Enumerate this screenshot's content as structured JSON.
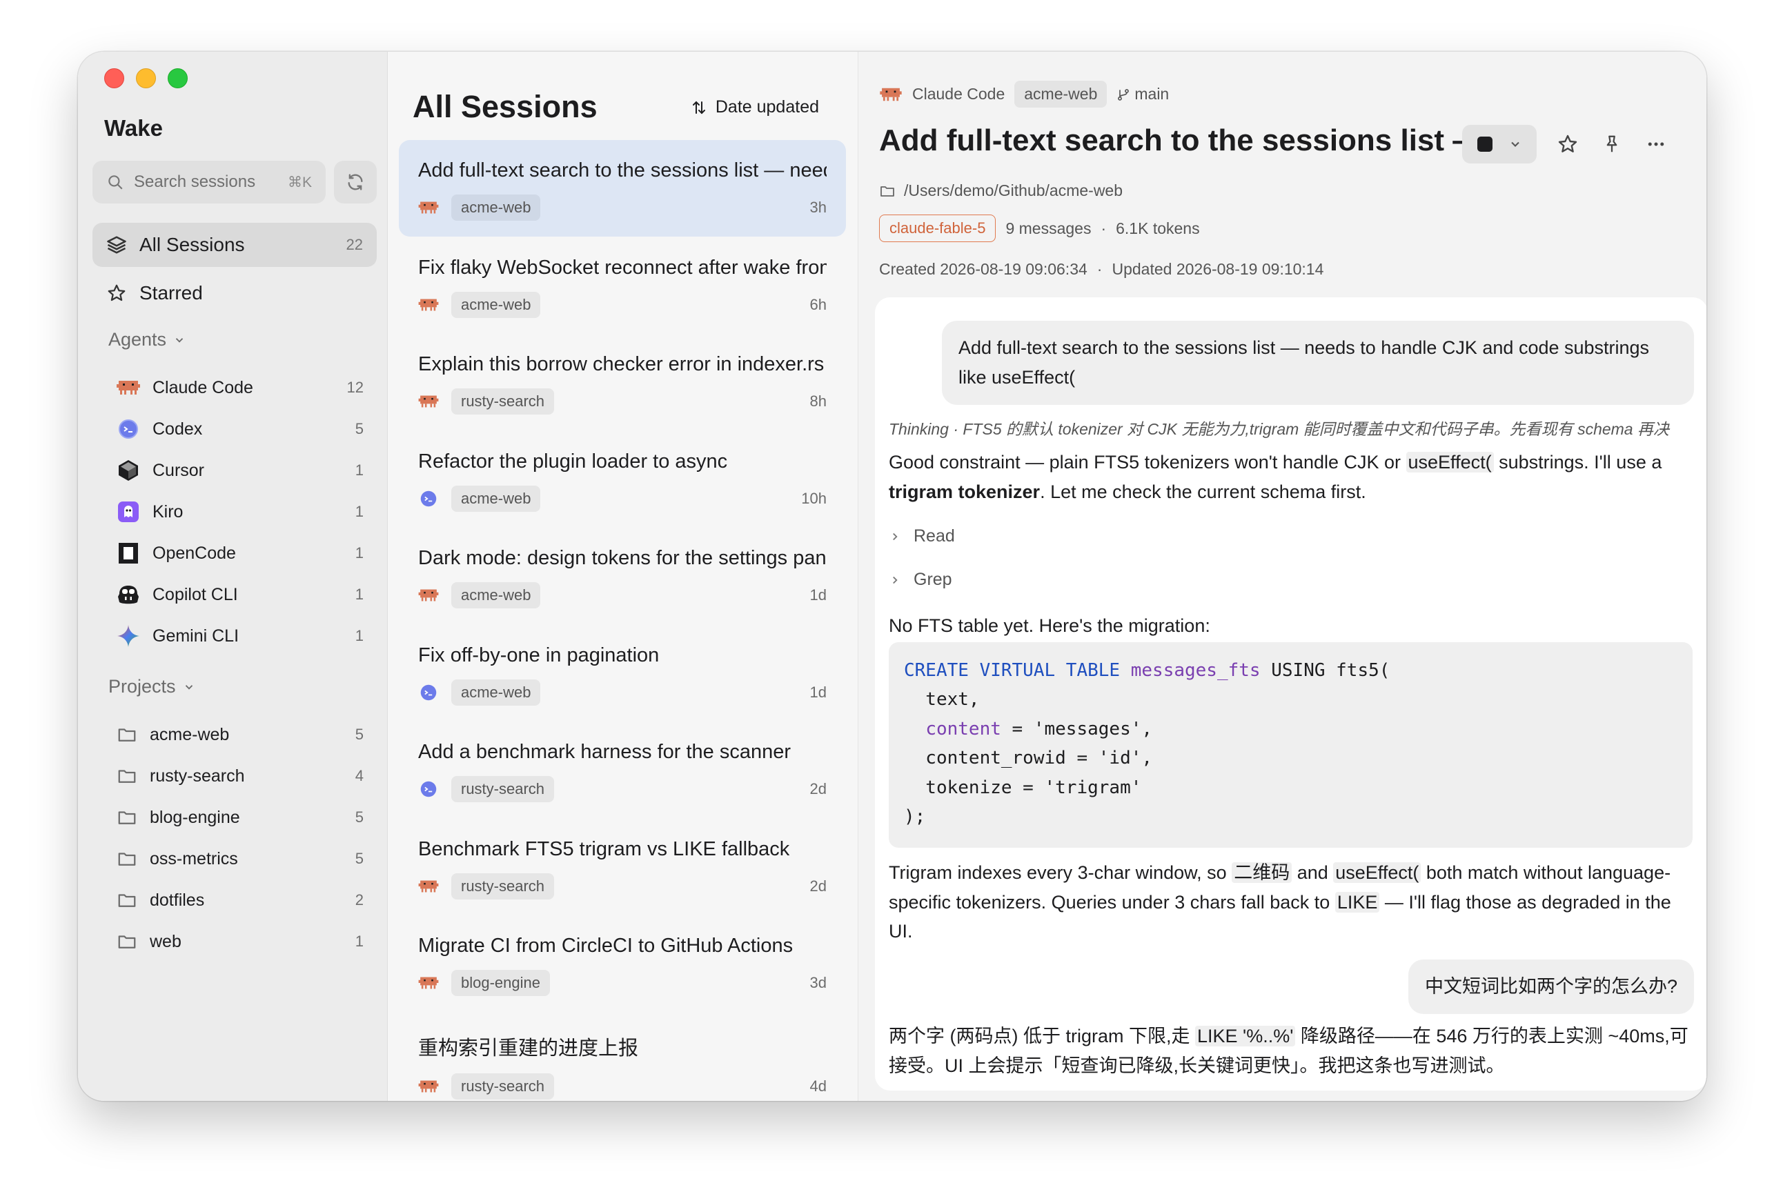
{
  "sidebar": {
    "app_title": "Wake",
    "search_placeholder": "Search sessions",
    "search_shortcut": "⌘K",
    "nav": [
      {
        "label": "All Sessions",
        "count": "22",
        "icon": "stack-icon"
      },
      {
        "label": "Starred",
        "count": "",
        "icon": "star-icon"
      }
    ],
    "agents_heading": "Agents",
    "agents": [
      {
        "label": "Claude Code",
        "count": "12",
        "icon": "claude-code-icon",
        "color": "#d97757"
      },
      {
        "label": "Codex",
        "count": "5",
        "icon": "codex-icon",
        "color": "#5b6ee1"
      },
      {
        "label": "Cursor",
        "count": "1",
        "icon": "cursor-icon",
        "color": "#1d1d1f"
      },
      {
        "label": "Kiro",
        "count": "1",
        "icon": "kiro-icon",
        "color": "#8b5cf6"
      },
      {
        "label": "OpenCode",
        "count": "1",
        "icon": "opencode-icon",
        "color": "#1d1d1f"
      },
      {
        "label": "Copilot CLI",
        "count": "1",
        "icon": "copilot-icon",
        "color": "#1d1d1f"
      },
      {
        "label": "Gemini CLI",
        "count": "1",
        "icon": "gemini-icon",
        "color": "#4a7df0"
      }
    ],
    "projects_heading": "Projects",
    "projects": [
      {
        "label": "acme-web",
        "count": "5"
      },
      {
        "label": "rusty-search",
        "count": "4"
      },
      {
        "label": "blog-engine",
        "count": "5"
      },
      {
        "label": "oss-metrics",
        "count": "5"
      },
      {
        "label": "dotfiles",
        "count": "2"
      },
      {
        "label": "web",
        "count": "1"
      }
    ]
  },
  "sessions": {
    "title": "All Sessions",
    "sort_label": "Date updated",
    "items": [
      {
        "title": "Add full-text search to the sessions list — needs to handle CJK and code substrings like useEffect(",
        "project": "acme-web",
        "time": "3h",
        "agent": "claude"
      },
      {
        "title": "Fix flaky WebSocket reconnect after wake from sleep",
        "project": "acme-web",
        "time": "6h",
        "agent": "claude"
      },
      {
        "title": "Explain this borrow checker error in indexer.rs",
        "project": "rusty-search",
        "time": "8h",
        "agent": "claude"
      },
      {
        "title": "Refactor the plugin loader to async",
        "project": "acme-web",
        "time": "10h",
        "agent": "codex"
      },
      {
        "title": "Dark mode: design tokens for the settings panel",
        "project": "acme-web",
        "time": "1d",
        "agent": "claude"
      },
      {
        "title": "Fix off-by-one in pagination",
        "project": "acme-web",
        "time": "1d",
        "agent": "codex"
      },
      {
        "title": "Add a benchmark harness for the scanner",
        "project": "rusty-search",
        "time": "2d",
        "agent": "codex"
      },
      {
        "title": "Benchmark FTS5 trigram vs LIKE fallback",
        "project": "rusty-search",
        "time": "2d",
        "agent": "claude"
      },
      {
        "title": "Migrate CI from CircleCI to GitHub Actions",
        "project": "blog-engine",
        "time": "3d",
        "agent": "claude"
      },
      {
        "title": "重构索引重建的进度上报",
        "project": "rusty-search",
        "time": "4d",
        "agent": "claude"
      }
    ]
  },
  "detail": {
    "agent_label": "Claude Code",
    "project_chip": "acme-web",
    "branch": "main",
    "title": "Add full-text search to the sessions list — needs to handle CJK and code substrings like useEffect(",
    "path": "/Users/demo/Github/acme-web",
    "model": "claude-fable-5",
    "messages": "9 messages",
    "tokens": "6.1K tokens",
    "created": "Created 2026-08-19 09:06:34",
    "updated": "Updated 2026-08-19 09:10:14",
    "dot": "·"
  },
  "conversation": {
    "user1": "Add full-text search to the sessions list — needs to handle CJK and code substrings like useEffect(",
    "thinking": "Thinking · FTS5 的默认 tokenizer 对 CJK 无能为力,trigram 能同时覆盖中文和代码子串。先看现有 schema 再决",
    "a1_part1": "Good constraint — plain FTS5 tokenizers won't handle CJK or ",
    "a1_code": "useEffect(",
    "a1_part2": " substrings. I'll use a ",
    "a1_bold": "trigram tokenizer",
    "a1_part3": ". Let me check the current schema first.",
    "tool1": "Read",
    "tool2": "Grep",
    "a2": "No FTS table yet. Here's the migration:",
    "code": {
      "l1_kw": "CREATE VIRTUAL TABLE",
      "l1_name": "messages_fts",
      "l1_rest": " USING fts5(",
      "l2": "  text,",
      "l3_kw": "content",
      "l3_rest": " = 'messages',",
      "l4": "  content_rowid = 'id',",
      "l5": "  tokenize = 'trigram'",
      "l6": ");"
    },
    "a3_part1": "Trigram indexes every 3-char window, so ",
    "a3_code1": "二维码",
    "a3_part2": " and ",
    "a3_code2": "useEffect(",
    "a3_part3": " both match without language-specific tokenizers. Queries under 3 chars fall back to ",
    "a3_code3": "LIKE",
    "a3_part4": " — I'll flag those as degraded in the UI.",
    "user2": "中文短词比如两个字的怎么办?",
    "a4_part1": "两个字 (两码点) 低于 trigram 下限,走 ",
    "a4_code": "LIKE '%..%'",
    "a4_part2": " 降级路径——在 546 万行的表上实测 ~40ms,可接受。UI 上会提示「短查询已降级,长关键词更快」。我把这条也写进测试。"
  }
}
